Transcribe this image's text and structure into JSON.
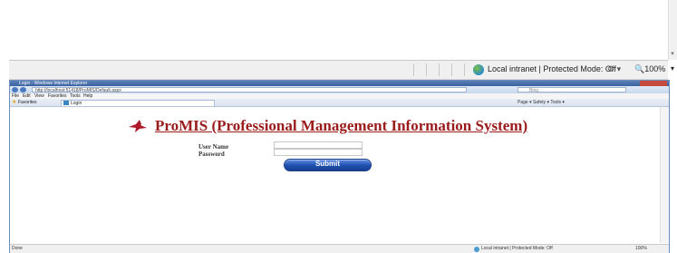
{
  "statusbar": {
    "zone_text": "Local intranet | Protected Mode: Off",
    "zoom_text": "100%"
  },
  "browser": {
    "title": "Login - Windows Internet Explorer",
    "address": "http://localhost:51418/ProMIS/Default.aspx",
    "search_placeholder": "Bing",
    "menu": [
      "File",
      "Edit",
      "View",
      "Favorites",
      "Tools",
      "Help"
    ],
    "favorites_label": "Favorites",
    "tab_title": "Login",
    "command_bar": "Page ▾  Safety ▾  Tools ▾",
    "status_left": "Done",
    "status_zone": "Local intranet | Protected Mode: Off",
    "status_zoom": "100%"
  },
  "page": {
    "title": "ProMIS (Professional Management Information System)",
    "username_label": "User Name",
    "password_label": "Password",
    "submit_label": "Submit",
    "username_value": "",
    "password_value": ""
  },
  "icons": {
    "zone": "globe-icon",
    "logo": "bird-logo-icon"
  },
  "colors": {
    "title": "#9a1b1b",
    "button": "#1f4fae"
  }
}
